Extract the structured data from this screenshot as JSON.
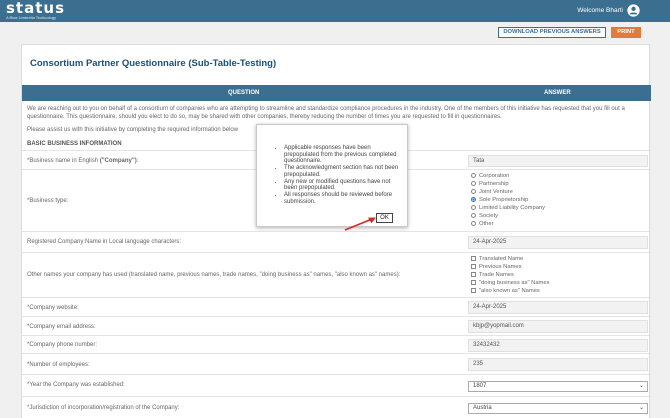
{
  "header": {
    "logo_text": "status",
    "logo_tagline": "A Blue Umbrella Technology",
    "welcome_text": "Welcome Bharti"
  },
  "toolbar": {
    "download_label": "DOWNLOAD PREVIOUS ANSWERS",
    "print_label": "PRINT"
  },
  "page": {
    "title": "Consortium Partner Questionnaire (Sub-Table-Testing)",
    "col_question": "QUESTION",
    "col_answer": "ANSWER",
    "intro": "We are reaching out to you on behalf of a consortium of companies who are attempting to streamline and standardize compliance procedures in the industry. One of the members of this initiative has requested that you fill out a questionnaire. This questionnaire, should you elect to do so, may be shared with other companies, thereby reducing the number of times you are requested to fill in questionnaires.",
    "assist": "Please assist us with this initiative by completing the required information below",
    "section": "BASIC BUSINESS INFORMATION"
  },
  "form": {
    "business_name_label": "*Business name in English",
    "business_name_suffix": "(\"Company\")",
    "business_name_value": "Tata",
    "business_type_label": "*Business type:",
    "business_type_options": [
      "Corporation",
      "Partnership",
      "Joint Venture",
      "Sole Proprietorship",
      "Limited Liability Company",
      "Society",
      "Other"
    ],
    "business_type_selected": "Sole Proprietorship",
    "local_name_label": "Registered Company Name in Local language characters:",
    "local_name_value": "24-Apr-2025",
    "other_names_label": "Other names your company has used (translated name, previous names, trade names, \"doing business as\" names, \"also known as\" names):",
    "other_names_options": [
      "Translated Name",
      "Previous Names",
      "Trade Names",
      "\"doing business as\" Names",
      "\"also known as\" Names"
    ],
    "website_label": "*Company website:",
    "website_value": "24-Apr-2025",
    "email_label": "*Company email address:",
    "email_value": "kbjp@yopmail.com",
    "phone_label": "*Company phone number:",
    "phone_value": "32432432",
    "employees_label": "*Number of employees:",
    "employees_value": "235",
    "year_label": "*Year the Company was established:",
    "year_value": "1807",
    "jurisdiction_label": "*Jurisdiction of incorporation/registration of the Company:",
    "jurisdiction_value": "Austria"
  },
  "modal": {
    "items": [
      "Applicable responses have been prepopulated from the previous completed questionnaire.",
      "The acknowledgment section has not been prepopulated.",
      "Any new or modified questions have not been prepopulated.",
      "All responses should be reviewed before submission."
    ],
    "ok_label": "OK"
  },
  "colors": {
    "header_bg": "#3b6e8f",
    "title": "#1f4f72",
    "print_button": "#e07b39",
    "arrow": "#d62828"
  }
}
